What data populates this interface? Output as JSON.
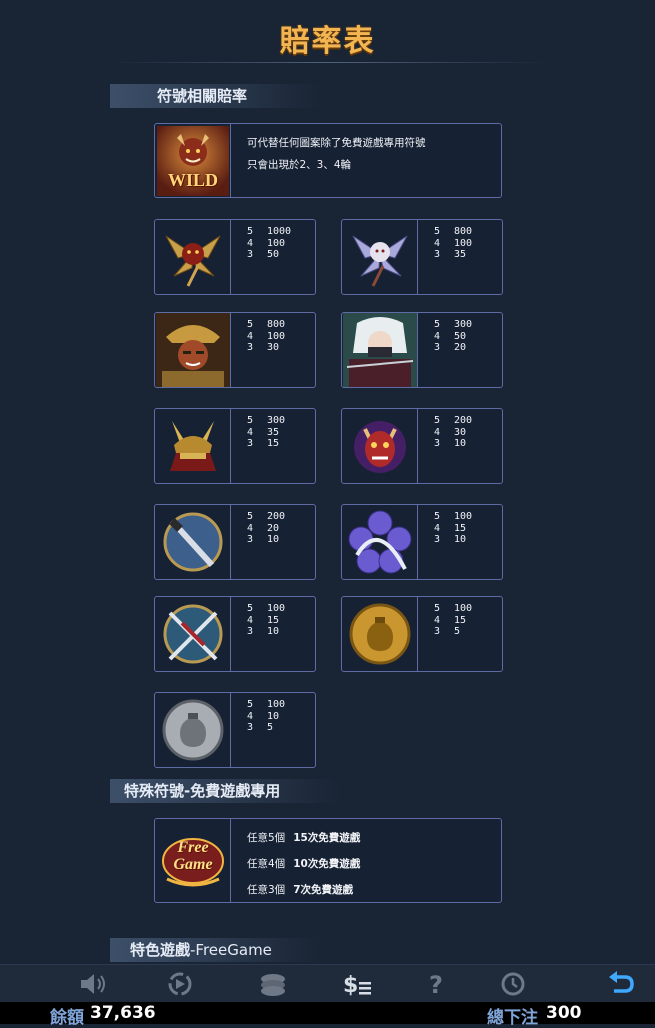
{
  "page_title": "賠率表",
  "sections": {
    "symbols": "符號相關賠率",
    "special": "特殊符號-免費遊戲專用",
    "feature_prefix": "特色遊戲",
    "feature_suffix": "-FreeGame"
  },
  "wild": {
    "badge": "WILD",
    "line1": "可代替任何圖案除了免費遊戲專用符號",
    "line2": "只會出現於2、3、4輪"
  },
  "symbols": [
    {
      "icon": "gold-flower-demon-icon",
      "rows": [
        [
          "5",
          "1000"
        ],
        [
          "4",
          "100"
        ],
        [
          "3",
          "50"
        ]
      ]
    },
    {
      "icon": "lavender-flower-demon-icon",
      "rows": [
        [
          "5",
          "800"
        ],
        [
          "4",
          "100"
        ],
        [
          "3",
          "35"
        ]
      ]
    },
    {
      "icon": "samurai-warrior-icon",
      "rows": [
        [
          "5",
          "800"
        ],
        [
          "4",
          "100"
        ],
        [
          "3",
          "30"
        ]
      ]
    },
    {
      "icon": "white-haired-ninja-icon",
      "rows": [
        [
          "5",
          "300"
        ],
        [
          "4",
          "50"
        ],
        [
          "3",
          "20"
        ]
      ]
    },
    {
      "icon": "samurai-helmet-icon",
      "rows": [
        [
          "5",
          "300"
        ],
        [
          "4",
          "35"
        ],
        [
          "3",
          "15"
        ]
      ]
    },
    {
      "icon": "oni-mask-icon",
      "rows": [
        [
          "5",
          "200"
        ],
        [
          "4",
          "30"
        ],
        [
          "3",
          "10"
        ]
      ]
    },
    {
      "icon": "katana-medallion-icon",
      "rows": [
        [
          "5",
          "200"
        ],
        [
          "4",
          "20"
        ],
        [
          "3",
          "10"
        ]
      ]
    },
    {
      "icon": "purple-flower-blade-icon",
      "rows": [
        [
          "5",
          "100"
        ],
        [
          "4",
          "15"
        ],
        [
          "3",
          "10"
        ]
      ]
    },
    {
      "icon": "crossed-swords-medallion-icon",
      "rows": [
        [
          "5",
          "100"
        ],
        [
          "4",
          "15"
        ],
        [
          "3",
          "10"
        ]
      ]
    },
    {
      "icon": "gold-pouch-coin-icon",
      "rows": [
        [
          "5",
          "100"
        ],
        [
          "4",
          "15"
        ],
        [
          "3",
          "5"
        ]
      ]
    },
    {
      "icon": "silver-pouch-coin-icon",
      "rows": [
        [
          "5",
          "100"
        ],
        [
          "4",
          "10"
        ],
        [
          "3",
          "5"
        ]
      ]
    }
  ],
  "free_game": {
    "badge_line1": "Free",
    "badge_line2": "Game",
    "rows": [
      {
        "label": "任意5個",
        "value": "15次免費遊戲"
      },
      {
        "label": "任意4個",
        "value": "10次免費遊戲"
      },
      {
        "label": "任意3個",
        "value": "7次免費遊戲"
      }
    ]
  },
  "toolbar": [
    {
      "name": "sound-icon"
    },
    {
      "name": "autoplay-icon"
    },
    {
      "name": "chips-icon"
    },
    {
      "name": "paytable-icon"
    },
    {
      "name": "help-icon"
    },
    {
      "name": "history-icon"
    },
    {
      "name": "back-icon"
    }
  ],
  "status": {
    "balance_label": "餘額",
    "balance_value": "37,636",
    "bet_label": "總下注",
    "bet_value": "300"
  },
  "colors": {
    "background": "#192434",
    "title": "#f2b552",
    "border": "#5f6ba3",
    "status_label": "#7fa5d8",
    "active_icon": "#3fa8ff"
  }
}
